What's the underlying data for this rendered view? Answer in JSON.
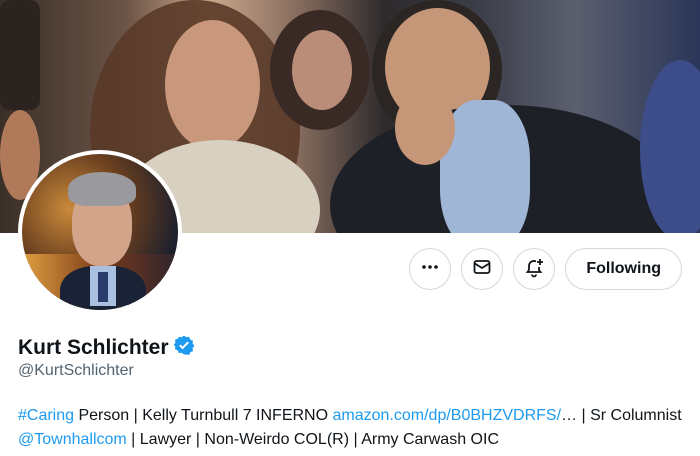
{
  "profile": {
    "name": "Kurt Schlichter",
    "handle": "@KurtSchlichter",
    "verified": true
  },
  "actions": {
    "more_icon": "more-icon",
    "message_icon": "mail-icon",
    "notify_icon": "bell-plus-icon",
    "follow_label": "Following"
  },
  "bio": {
    "hashtag": "#Caring",
    "part1": " Person | Kelly Turnbull 7 INFERNO ",
    "url": "amazon.com/dp/B0BHZVDRFS/",
    "part2": "… | Sr Columnist ",
    "mention": "@Townhallcom",
    "part3": " | Lawyer | Non-Weirdo COL(R) | Army Carwash OIC"
  },
  "colors": {
    "accent": "#1d9bf0",
    "text": "#0f1419",
    "secondary": "#536471",
    "border": "#cfd9de"
  }
}
